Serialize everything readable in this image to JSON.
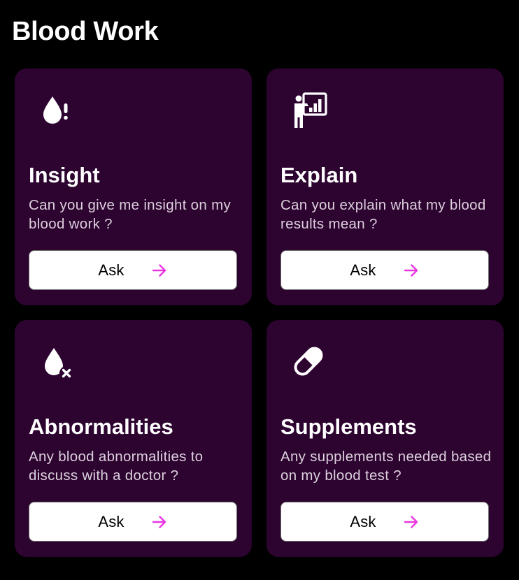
{
  "header": {
    "title": "Blood Work"
  },
  "colors": {
    "background": "#000000",
    "card": "#2d0330",
    "accent_arrow": "#e935e0",
    "button": "#ffffff",
    "description_text": "#dcd0dd"
  },
  "cards": [
    {
      "title": "Insight",
      "description": "Can you give me insight on my blood work ?",
      "button_label": "Ask",
      "icon": "blood-drop-exclamation-icon"
    },
    {
      "title": "Explain",
      "description": "Can you explain what my blood results mean ?",
      "button_label": "Ask",
      "icon": "presenter-chart-icon"
    },
    {
      "title": "Abnormalities",
      "description": "Any blood abnormalities to discuss with a doctor ?",
      "button_label": "Ask",
      "icon": "blood-drop-x-icon"
    },
    {
      "title": "Supplements",
      "description": "Any supplements needed based on my blood test ?",
      "button_label": "Ask",
      "icon": "pill-capsule-icon"
    }
  ]
}
